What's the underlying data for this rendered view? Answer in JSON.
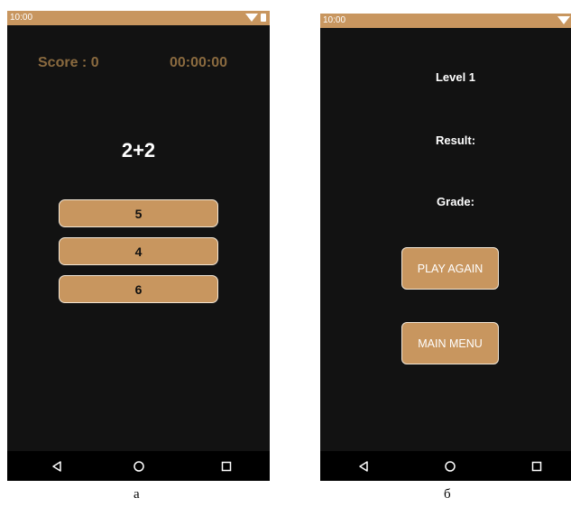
{
  "screen_a": {
    "status_time": "10:00",
    "score_label": "Score : 0",
    "timer": "00:00:00",
    "question": "2+2",
    "answers": [
      "5",
      "4",
      "6"
    ],
    "caption": "a"
  },
  "screen_b": {
    "status_time": "10:00",
    "level": "Level 1",
    "result_label": "Result:",
    "grade_label": "Grade:",
    "play_again": "PLAY AGAIN",
    "main_menu": "MAIN MENU",
    "caption": "б"
  },
  "colors": {
    "accent": "#c8965f",
    "background": "#121212",
    "score_text": "#8a6a3f"
  },
  "icons": {
    "status": [
      "wifi-icon",
      "battery-icon"
    ],
    "nav": [
      "back-icon",
      "home-icon",
      "recents-icon"
    ]
  }
}
